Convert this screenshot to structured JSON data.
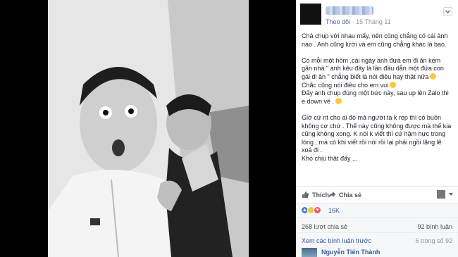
{
  "post": {
    "follow_label": "Theo dõi",
    "separator": "·",
    "date": "15 Tháng 11",
    "more_icon": "chevron-down-icon"
  },
  "caption": {
    "paragraphs": [
      "Chả chụp với nhau mấy, nên cũng chẳng có cái ảnh nào . Anh cũng lười và em cũng chẳng khác là bao.",
      "Có mỗi một hôm ,cái ngày anh đưa em đi ăn kem gần nhà \" anh kêu đây là lần đầu dẫn một đứa con gái đi ăn \" chẳng biết là nói điêu hay thật nữa",
      "Chắc cũng nói điêu cho em vui",
      "Đấy anh chụp đúng một bức này, sau up lên Zalo thì e down về .",
      "Giờ cứ nt cho ai đó mà người ta k rep thì có buồn không cơ chứ . Thế này cũng không được mà thế kia cũng không xong. K nói k viết thì cứ hậm hực trong lòng , mà có khi viết rồi nói rồi lại phải ngồi lặng lẽ xoá đi .\nKhó chịu thật đấy ..."
    ]
  },
  "actions": {
    "like_label": "Thích",
    "share_label": "Chia sẻ"
  },
  "reactions": {
    "count": "16K",
    "icons": [
      "like-icon",
      "sad-icon",
      "love-icon"
    ]
  },
  "stats": {
    "shares": "268 lượt chia sẻ",
    "comments": "92 bình luận"
  },
  "comments": {
    "view_previous": "Xem các bình luận trước",
    "pager": "6 trong số 92",
    "first_author": "Nguyễn Tiến Thành"
  },
  "colors": {
    "link": "#365899",
    "like": "#4f78d9",
    "love": "#f25268",
    "sad": "#f4c843"
  }
}
